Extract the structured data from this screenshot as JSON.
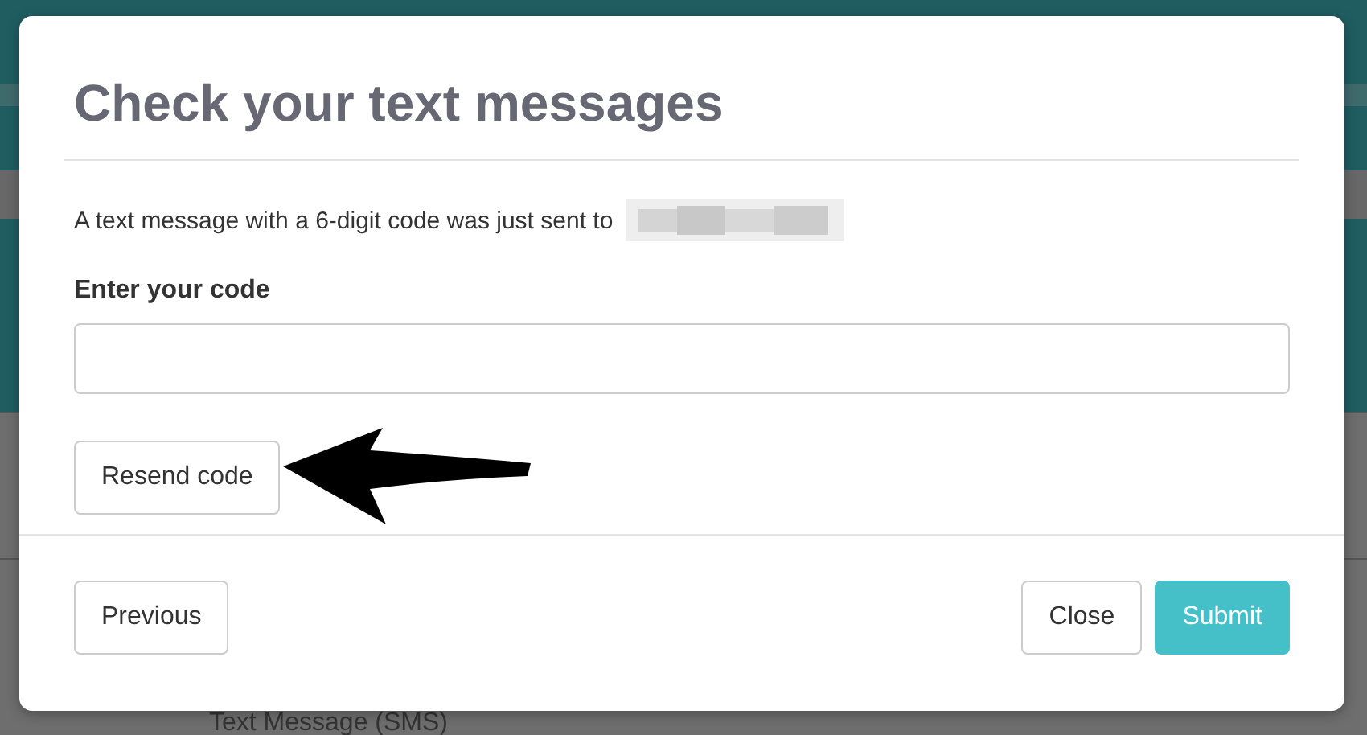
{
  "background": {
    "list_item": "Text Message (SMS)"
  },
  "dialog": {
    "title": "Check your text messages",
    "message": "A text message with a 6-digit code was just sent to",
    "code_field": {
      "label": "Enter your code"
    },
    "resend_button": "Resend code",
    "footer": {
      "previous_button": "Previous",
      "close_button": "Close",
      "submit_button": "Submit"
    }
  }
}
